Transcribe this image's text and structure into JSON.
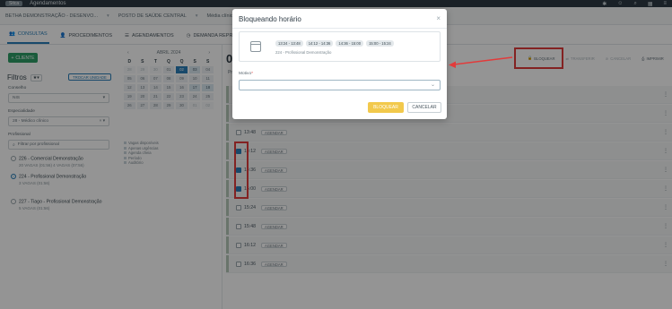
{
  "topbar": {
    "logo": "Sitca",
    "app_title": "Agendamentos"
  },
  "context": {
    "org": "BETHA DEMONSTRAÇÃO - DESENVO...",
    "unit": "POSTO DE SAÚDE CENTRAL",
    "more": "Média clínica"
  },
  "tabs": [
    "CONSULTAS",
    "PROCEDIMENTOS",
    "AGENDAMENTOS",
    "DEMANDA REPRIMIDA"
  ],
  "new_button": "CLIENTE",
  "filters": {
    "title": "Filtros",
    "switch_unit": "TROCAR UNIDADE",
    "conselho_label": "Conselho",
    "conselho_value": "NIS",
    "especialidade_label": "Especialidade",
    "especialidade_value": "28 - Médico clínico",
    "profissional_label": "Profissional",
    "profissional_placeholder": "Filtrar por profissional"
  },
  "professionals": [
    {
      "name": "226 - Comercial Demonstração",
      "sub": "20 VAGAS (01:56)   4 VAGAS (07:56)",
      "selected": false
    },
    {
      "name": "224 - Profissional Demonstração",
      "sub": "3 VAGAS (01:56)",
      "selected": true
    },
    {
      "name": "227 - Tiago - Profissional Demonstração",
      "sub": "5 VAGAS (01:56)",
      "selected": false
    }
  ],
  "calendar": {
    "month": "ABRIL 2024",
    "weekdays": [
      "D",
      "S",
      "T",
      "Q",
      "Q",
      "S",
      "S"
    ],
    "days": [
      "28",
      "29",
      "30",
      "01",
      "02",
      "03",
      "04",
      "05",
      "06",
      "07",
      "08",
      "09",
      "10",
      "11",
      "12",
      "13",
      "14",
      "15",
      "16",
      "17",
      "18",
      "19",
      "20",
      "21",
      "22",
      "23",
      "24",
      "25",
      "26",
      "27",
      "28",
      "29",
      "30",
      "01",
      "02"
    ],
    "selected_day": "02",
    "legend": [
      "Vagas disponíveis",
      "Apenas urgências",
      "Agenda cheia",
      "Período",
      "Auditório"
    ]
  },
  "schedule": {
    "date": "0",
    "prof_label": "Pr",
    "actions": [
      "BLOQUEAR",
      "TRANSFERIR",
      "CANCELAR",
      "IMPRIMIR"
    ],
    "rows": [
      {
        "time": "",
        "tag": "",
        "checked": false
      },
      {
        "time": "",
        "tag": "",
        "checked": false
      },
      {
        "time": "13:48",
        "tag": "AGENDAR",
        "checked": false
      },
      {
        "time": "14:12",
        "tag": "AGENDAR",
        "checked": true
      },
      {
        "time": "14:36",
        "tag": "AGENDAR",
        "checked": true
      },
      {
        "time": "15:00",
        "tag": "AGENDAR",
        "checked": true
      },
      {
        "time": "15:24",
        "tag": "AGENDAR",
        "checked": false
      },
      {
        "time": "15:48",
        "tag": "AGENDAR",
        "checked": false
      },
      {
        "time": "16:12",
        "tag": "AGENDAR",
        "checked": false
      },
      {
        "time": "16:36",
        "tag": "AGENDAR",
        "checked": false
      }
    ]
  },
  "modal": {
    "title": "Bloqueando horário",
    "slots": [
      "13:24 - 13:48",
      "14:12 - 14:36",
      "14:36 - 15:00",
      "15:00 - 15:24"
    ],
    "professional": "224 - Profissional Demonstração",
    "reason_label": "Motivo",
    "reason_value": "",
    "confirm": "BLOQUEAR",
    "cancel": "CANCELAR"
  },
  "colors": {
    "accent": "#2a7fb8",
    "annotation": "#e23b3b",
    "confirm": "#f2c94c",
    "new": "#2e9d67"
  }
}
